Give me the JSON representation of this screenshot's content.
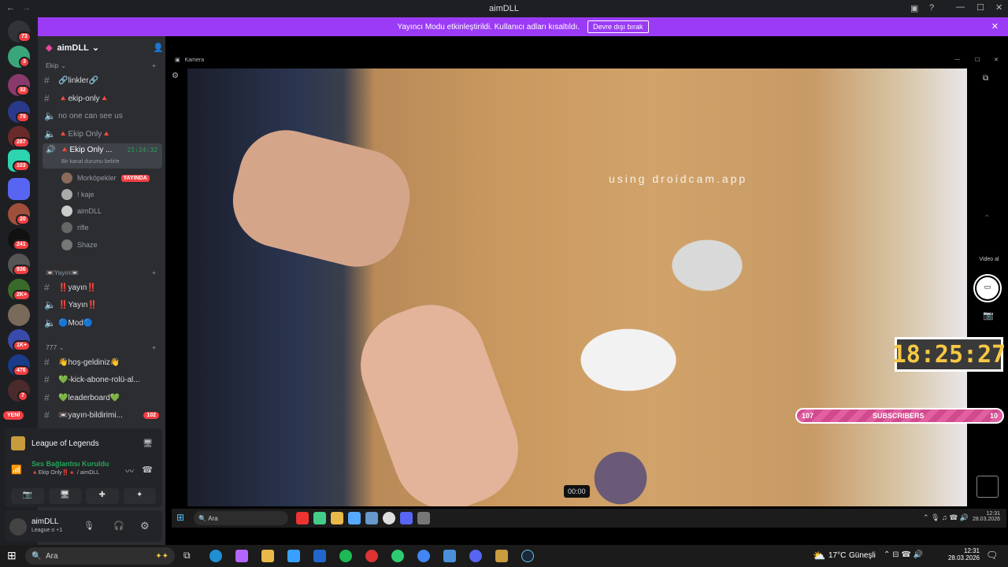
{
  "titlebar": {
    "title": "aimDLL"
  },
  "banner": {
    "text": "Yayıncı Modu etkinleştirildi. Kullanıcı adları kısaltıldı.",
    "button": "Devre dışı bırak"
  },
  "rail": {
    "badges": [
      "73",
      "3",
      "32",
      "79",
      "287",
      "103",
      "20",
      "241",
      "936",
      "2K+",
      "1K+",
      "476",
      "7"
    ],
    "new_label": "YENİ"
  },
  "server": {
    "name": "aimDLL"
  },
  "categories": {
    "ekip": "Ekip",
    "yayin": "Yayın",
    "c777": "777"
  },
  "channels": {
    "linkler": "🔗linkler🔗",
    "ekip_only": "🔺ekip-only🔺",
    "no_one": "no one can see us",
    "ekip_voice": "🔺Ekip Only🔺",
    "ekip_voice2": "🔺Ekip Only ...",
    "ekip_voice2_time": "21:24:32",
    "status_hint": "Bir kanal durumu belirle",
    "yayin1": "‼️yayın‼️",
    "yayin2": "‼️Yayın‼️",
    "mod": "🔵Mod🔵",
    "hos": "👋hoş-geldiniz👋",
    "kick": "💚-kick-abone-rolü-al...",
    "leaderboard": "💚leaderboard💚",
    "yayin_bildirim": "📼yayın-bildirimi...",
    "yayin_bildirim_badge": "102"
  },
  "voice_users": [
    {
      "name": "Morköpekler",
      "live": "YAYINDA"
    },
    {
      "name": "! kaje"
    },
    {
      "name": "aimDLL"
    },
    {
      "name": "rifle"
    },
    {
      "name": "Shaze"
    }
  ],
  "activity": {
    "game": "League of Legends"
  },
  "voice": {
    "status": "Ses Bağlantısı Kuruldu",
    "channel": "🔺Ekip Only‼️🔺 / aimDLL"
  },
  "user": {
    "name": "aimDLL",
    "status": "League o +1"
  },
  "camera": {
    "title": "Kamera",
    "watermark": "using droidcam.app",
    "timestamp": "00:00",
    "take_video": "Video al"
  },
  "overlay": {
    "clock": "18:25:27",
    "sub_left": "107",
    "sub_label": "SUBSCRIBERS",
    "sub_right": "10"
  },
  "inner_taskbar": {
    "search": "Ara",
    "time": "12:31",
    "date": "28.03.2026"
  },
  "taskbar": {
    "search": "Ara",
    "weather": "17°C",
    "weather_label": "Güneşli",
    "time": "12:31",
    "date": "28.03.2026"
  }
}
